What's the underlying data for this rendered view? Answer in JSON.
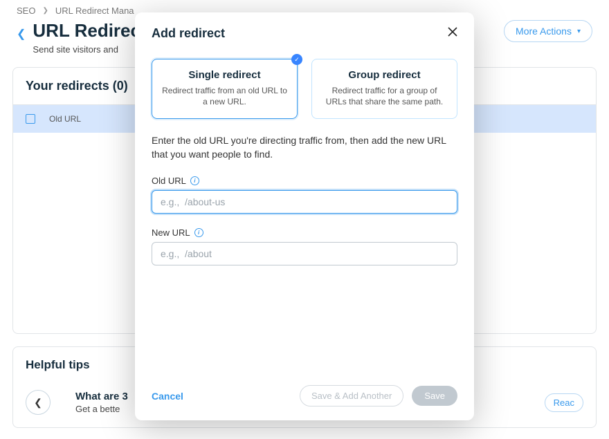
{
  "breadcrumb": {
    "item1": "SEO",
    "item2": "URL Redirect Mana"
  },
  "page": {
    "title": "URL Redirec",
    "subtitle": "Send site visitors and",
    "more_actions": "More Actions"
  },
  "redirects_panel": {
    "header": "Your redirects (0)",
    "col_old": "Old URL"
  },
  "tips": {
    "header": "Helpful tips",
    "card_title": "What are 3",
    "card_sub": "Get a bette",
    "read": "Reac"
  },
  "modal": {
    "title": "Add redirect",
    "option_single": {
      "title": "Single redirect",
      "desc": "Redirect traffic from an old URL to a new URL."
    },
    "option_group": {
      "title": "Group redirect",
      "desc": "Redirect traffic for a group of URLs that share the same path."
    },
    "instructions": "Enter the old URL you're directing traffic from, then add the new URL that you want people to find.",
    "old_label": "Old URL",
    "old_placeholder": "e.g.,  /about-us",
    "new_label": "New URL",
    "new_placeholder": "e.g.,  /about",
    "cancel": "Cancel",
    "save_another": "Save & Add Another",
    "save": "Save"
  }
}
